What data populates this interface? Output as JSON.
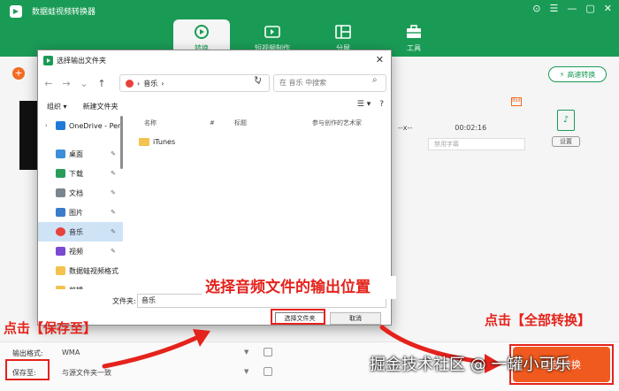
{
  "app": {
    "title": "数据蛙视频转换器",
    "win_controls": [
      "⊙",
      "☰",
      "—",
      "▢",
      "✕"
    ],
    "nav": [
      {
        "label": "转换",
        "icon": "convert-icon",
        "active": true
      },
      {
        "label": "短视频制作",
        "icon": "video-icon",
        "active": false
      },
      {
        "label": "分屏",
        "icon": "split-screen-icon",
        "active": false
      },
      {
        "label": "工具",
        "icon": "toolbox-icon",
        "active": false
      }
    ],
    "add_symbol": "+",
    "speed_label": "高速转换",
    "file_info": {
      "sep": "--x--",
      "duration": "00:02:16"
    },
    "subtitle_placeholder": "禁用字幕",
    "format_badge": "♪",
    "settings_label": "设置",
    "convert_icon_label": "8bit"
  },
  "bottom": {
    "output_format_label": "输出格式:",
    "output_format_value": "WMA",
    "save_to_label": "保存至:",
    "save_to_value": "与源文件夹一致",
    "convert_all_label": "全部转换"
  },
  "dialog": {
    "title": "选择输出文件夹",
    "close": "✕",
    "nav_back": "←",
    "nav_forward": "→",
    "nav_dropdown": "⌄",
    "nav_up": "↑",
    "address": "音乐",
    "address_sep": "›",
    "address_chevron": "⌄",
    "refresh": "↻",
    "search_placeholder": "在 音乐 中搜索",
    "search_icon": "⌕",
    "toolbar": {
      "organize": "组织 ▾",
      "new_folder": "新建文件夹",
      "view": "☰ ▾",
      "help": "?"
    },
    "sidebar": [
      {
        "label": "OneDrive - Per",
        "icon": "onedrive-icon",
        "color": "#1f7ad6",
        "pinned": false,
        "expand": "›"
      },
      {
        "label": "桌面",
        "icon": "desktop-icon",
        "color": "#3b8fd8",
        "pinned": true
      },
      {
        "label": "下载",
        "icon": "download-icon",
        "color": "#2a9c5a",
        "pinned": true
      },
      {
        "label": "文档",
        "icon": "document-icon",
        "color": "#7a8590",
        "pinned": true
      },
      {
        "label": "图片",
        "icon": "picture-icon",
        "color": "#3a7cc8",
        "pinned": true
      },
      {
        "label": "音乐",
        "icon": "music-icon",
        "color": "#e8423a",
        "pinned": true,
        "selected": true
      },
      {
        "label": "视频",
        "icon": "video-icon",
        "color": "#7c4ad0",
        "pinned": true
      },
      {
        "label": "数据蛙视频格式",
        "icon": "folder-icon",
        "color": "#f3c24f",
        "pinned": false
      },
      {
        "label": "剪辑",
        "icon": "folder-icon",
        "color": "#f3c24f",
        "pinned": false
      }
    ],
    "pin_symbol": "📌",
    "columns": [
      "名称",
      "#",
      "标题",
      "参与创作的艺术家"
    ],
    "sort_indicator": "^",
    "files": [
      {
        "name": "iTunes",
        "icon": "folder-icon"
      }
    ],
    "filename_label": "文件夹:",
    "filename_value": "音乐",
    "select_button": "选择文件夹",
    "cancel_button": "取消"
  },
  "annotations": {
    "click_save_to": "点击【保存至】",
    "choose_location": "选择音频文件的输出位置",
    "click_convert_all": "点击【全部转换】",
    "watermark": "掘金技术社区 @ 一罐小可乐",
    "red": "#e4231c"
  }
}
